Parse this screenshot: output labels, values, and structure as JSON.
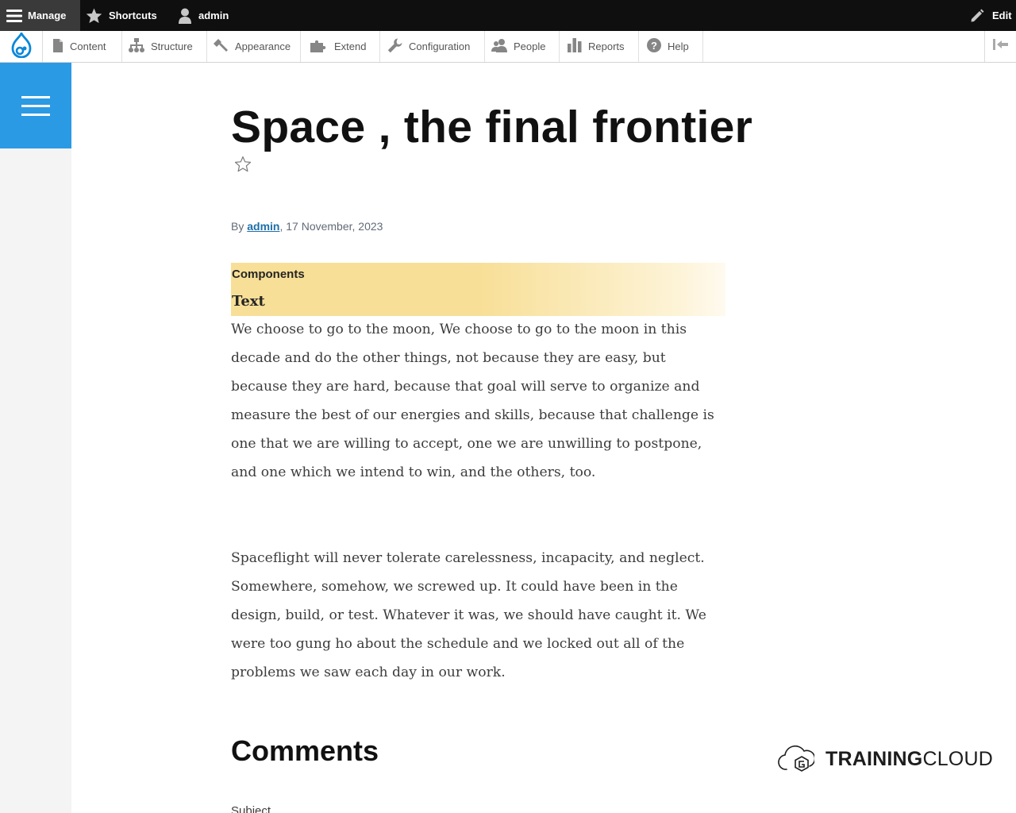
{
  "toolbar": {
    "manage": "Manage",
    "shortcuts": "Shortcuts",
    "user": "admin",
    "edit": "Edit"
  },
  "tray": {
    "items": [
      "Content",
      "Structure",
      "Appearance",
      "Extend",
      "Configuration",
      "People",
      "Reports",
      "Help"
    ]
  },
  "article": {
    "title": "Space , the final frontier",
    "by": "By ",
    "author": "admin",
    "date": ", 17 November, 2023",
    "components_label": "Components",
    "text_label": "Text",
    "paragraph1": "We choose to go to the moon, We choose to go to the moon in this decade and do the other things, not because they are easy, but because they are hard, because that goal will serve to organize and measure the best of our energies and skills, because that challenge is one that we are willing to accept, one we are unwilling to postpone, and one which we intend to win, and the others, too.",
    "paragraph2": "Spaceflight will never tolerate carelessness, incapacity, and neglect. Somewhere, somehow, we screwed up. It could have been in the design, build, or test. Whatever it was, we should have caught it. We were too gung ho about the schedule and we locked out all of the problems we saw each day in our work."
  },
  "comments": {
    "heading": "Comments",
    "subject_label": "Subject"
  },
  "brand": {
    "bold": "TRAINING",
    "light": "CLOUD"
  },
  "colors": {
    "toolbar_bg": "#0f0f0f",
    "manage_bg": "#3a3a3a",
    "drupal_blue": "#0b87d9",
    "sidebar_button": "#2b9ae4",
    "sidebar_bg": "#f3f4f3",
    "component_highlight": "#f8df97",
    "link": "#1e6fa8"
  },
  "icons": {
    "manage": "hamburger-icon",
    "shortcuts": "star-icon",
    "user": "user-icon",
    "edit": "pencil-icon",
    "logo": "drupal-drop-icon",
    "collapse": "collapse-tray-icon",
    "bookmark": "star-outline-icon",
    "brand": "cloud-logo-icon"
  }
}
